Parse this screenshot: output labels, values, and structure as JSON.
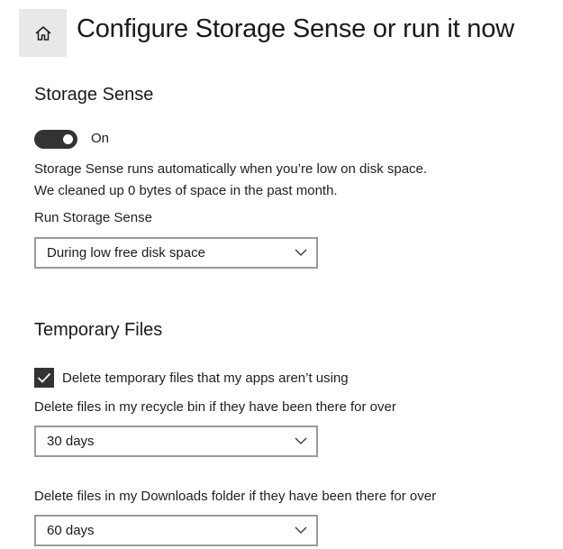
{
  "header": {
    "title": "Configure Storage Sense or run it now",
    "home_icon": "home-icon"
  },
  "storage_sense": {
    "title": "Storage Sense",
    "toggle_state_label": "On",
    "toggle_on": true,
    "description_line1": "Storage Sense runs automatically when you’re low on disk space.",
    "description_line2": "We cleaned up 0 bytes of space in the past month.",
    "run_label": "Run Storage Sense",
    "run_value": "During low free disk space"
  },
  "temporary_files": {
    "title": "Temporary Files",
    "delete_temp_label": "Delete temporary files that my apps aren’t using",
    "delete_temp_checked": true,
    "recycle_label": "Delete files in my recycle bin if they have been there for over",
    "recycle_value": "30 days",
    "downloads_label": "Delete files in my Downloads folder if they have been there for over",
    "downloads_value": "60 days"
  },
  "colors": {
    "accent_dark": "#333333",
    "dropdown_border": "#9a9a9a",
    "home_bg": "#e8e8e8"
  }
}
